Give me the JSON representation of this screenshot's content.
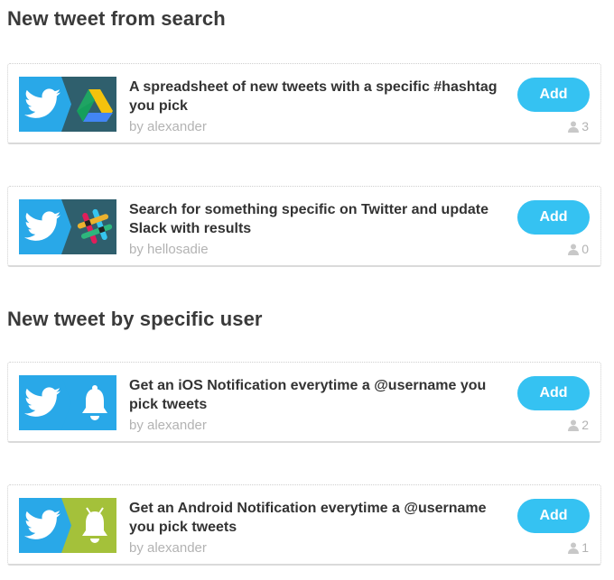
{
  "sections": [
    {
      "title": "New tweet from search",
      "cards": [
        {
          "title": "A spreadsheet of new tweets with a specific #hashtag you pick",
          "author": "by alexander",
          "add_label": "Add",
          "uses": "3",
          "app_icon": "google-drive-icon"
        },
        {
          "title": "Search for something specific on Twitter and update Slack with results",
          "author": "by hellosadie",
          "add_label": "Add",
          "uses": "0",
          "app_icon": "slack-icon"
        }
      ]
    },
    {
      "title": "New tweet by specific user",
      "cards": [
        {
          "title": "Get an iOS Notification everytime a @username you pick tweets",
          "author": "by alexander",
          "add_label": "Add",
          "uses": "2",
          "app_icon": "bell-icon"
        },
        {
          "title": "Get an Android Notification everytime a @username you pick tweets",
          "author": "by alexander",
          "add_label": "Add",
          "uses": "1",
          "app_icon": "android-bell-icon"
        }
      ]
    }
  ],
  "colors": {
    "twitter_blue": "#29a8e8",
    "add_button": "#35c2f2",
    "drive_tile": "#2f5f6d",
    "android_tile": "#a4c13a",
    "muted_text": "#b3b3b3"
  }
}
